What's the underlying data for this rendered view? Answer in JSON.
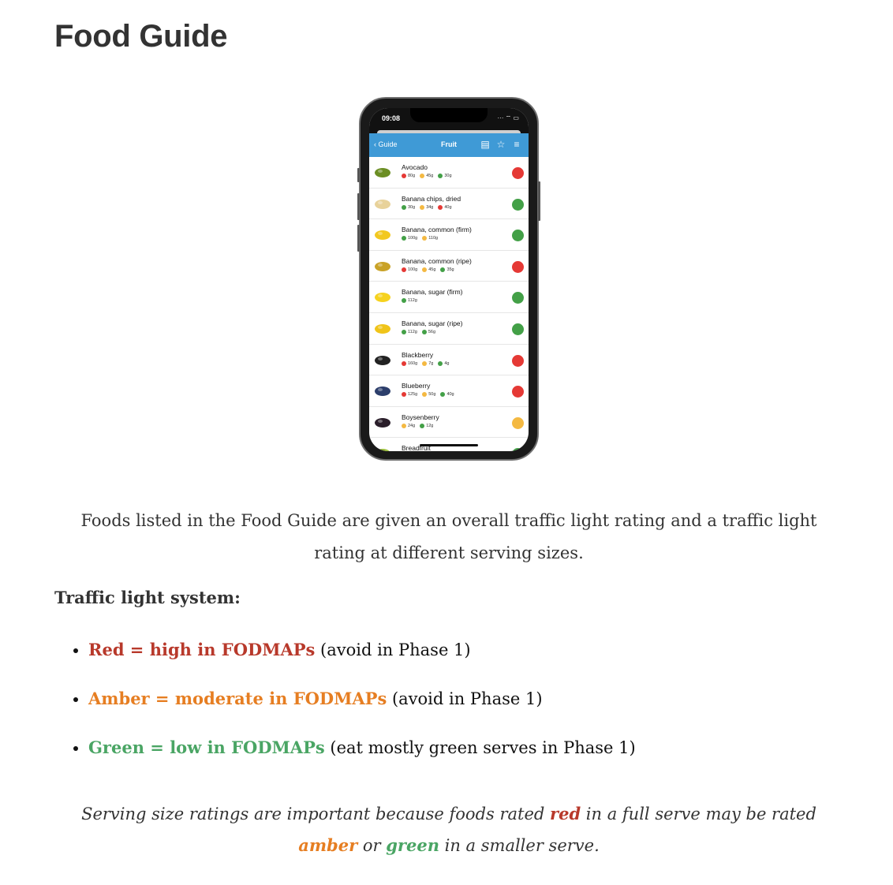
{
  "page_title": "Food Guide",
  "phone": {
    "time": "09:08",
    "status_icons": "···  ⌔ ▭",
    "back_label": "Guide",
    "screen_title": "Fruit",
    "colors": {
      "red": "#e53935",
      "amber": "#f4b942",
      "green": "#43a047",
      "navbar": "#3f9ad6"
    },
    "foods": [
      {
        "name": "Avocado",
        "icon": "avocado-icon",
        "overall": "red",
        "serves": [
          {
            "c": "red",
            "size": "80g"
          },
          {
            "c": "amber",
            "size": "45g"
          },
          {
            "c": "green",
            "size": "30g"
          }
        ]
      },
      {
        "name": "Banana chips, dried",
        "icon": "banana-chips-icon",
        "overall": "green",
        "serves": [
          {
            "c": "green",
            "size": "30g"
          },
          {
            "c": "amber",
            "size": "34g"
          },
          {
            "c": "red",
            "size": "40g"
          }
        ]
      },
      {
        "name": "Banana, common (firm)",
        "icon": "banana-icon",
        "overall": "green",
        "serves": [
          {
            "c": "green",
            "size": "100g"
          },
          {
            "c": "amber",
            "size": "110g"
          }
        ]
      },
      {
        "name": "Banana, common (ripe)",
        "icon": "ripe-banana-icon",
        "overall": "red",
        "serves": [
          {
            "c": "red",
            "size": "100g"
          },
          {
            "c": "amber",
            "size": "45g"
          },
          {
            "c": "green",
            "size": "35g"
          }
        ]
      },
      {
        "name": "Banana, sugar (firm)",
        "icon": "sugar-banana-icon",
        "overall": "green",
        "serves": [
          {
            "c": "green",
            "size": "112g"
          }
        ]
      },
      {
        "name": "Banana, sugar (ripe)",
        "icon": "sugar-banana-ripe-icon",
        "overall": "green",
        "serves": [
          {
            "c": "green",
            "size": "112g"
          },
          {
            "c": "green",
            "size": "56g"
          }
        ]
      },
      {
        "name": "Blackberry",
        "icon": "blackberry-icon",
        "overall": "red",
        "serves": [
          {
            "c": "red",
            "size": "160g"
          },
          {
            "c": "amber",
            "size": "7g"
          },
          {
            "c": "green",
            "size": "4g"
          }
        ]
      },
      {
        "name": "Blueberry",
        "icon": "blueberry-icon",
        "overall": "red",
        "serves": [
          {
            "c": "red",
            "size": "125g"
          },
          {
            "c": "amber",
            "size": "50g"
          },
          {
            "c": "green",
            "size": "40g"
          }
        ]
      },
      {
        "name": "Boysenberry",
        "icon": "boysenberry-icon",
        "overall": "amber",
        "serves": [
          {
            "c": "amber",
            "size": "24g"
          },
          {
            "c": "green",
            "size": "12g"
          }
        ]
      },
      {
        "name": "Breadfruit",
        "icon": "breadfruit-icon",
        "overall": "green",
        "serves": []
      }
    ]
  },
  "intro_text": "Foods listed in the Food Guide are given an overall traffic light rating and a traffic light rating at different serving sizes.",
  "legend_heading": "Traffic light system:",
  "legend": [
    {
      "label": "Red = high in FODMAPs",
      "note": " (avoid in Phase 1)",
      "color": "#b8392b"
    },
    {
      "label": "Amber = moderate in FODMAPs",
      "note": " (avoid in Phase 1)",
      "color": "#e67e22"
    },
    {
      "label": "Green = low in FODMAPs",
      "note": " (eat mostly green serves in Phase 1)",
      "color": "#4aa564"
    }
  ],
  "note": {
    "part1": "Serving size ratings are important because foods rated ",
    "red": "red",
    "part2": " in a full serve may be rated ",
    "amber": "amber",
    "part3": " or ",
    "green": "green",
    "part4": " in a smaller serve."
  }
}
